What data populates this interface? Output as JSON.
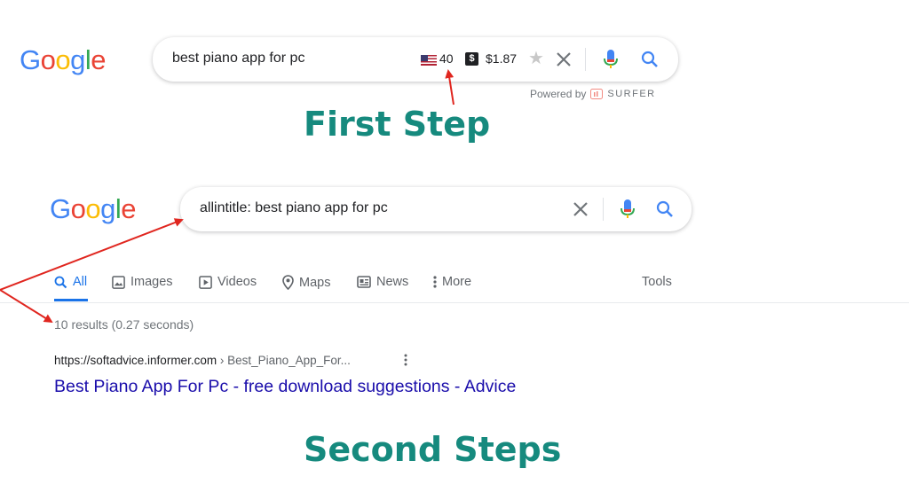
{
  "first": {
    "logo": "Google",
    "query": "best piano app for pc",
    "volume": "40",
    "cpc": "$1.87",
    "powered_by": "Powered by",
    "surfer": "SURFER",
    "step_title": "First Step"
  },
  "second": {
    "logo": "Google",
    "query": "allintitle: best piano app for pc",
    "tabs": [
      "All",
      "Images",
      "Videos",
      "Maps",
      "News",
      "More"
    ],
    "tools": "Tools",
    "stats": "10 results (0.27 seconds)",
    "result": {
      "url": "https://softadvice.informer.com",
      "crumb": " › Best_Piano_App_For...",
      "title": "Best Piano App For Pc - free download suggestions - Advice"
    },
    "step_title": "Second Steps"
  },
  "colors": {
    "accent_teal": "#168a7e",
    "annotation_red": "#e0261f",
    "google_blue": "#4285f4",
    "link_blue": "#1a0dab"
  },
  "icons": [
    "flag-us-icon",
    "dollar-icon",
    "star-icon",
    "close-icon",
    "mic-icon",
    "search-icon",
    "images-icon",
    "videos-icon",
    "maps-pin-icon",
    "news-icon",
    "more-dots-icon",
    "kebab-menu-icon",
    "surfer-logo-icon"
  ]
}
